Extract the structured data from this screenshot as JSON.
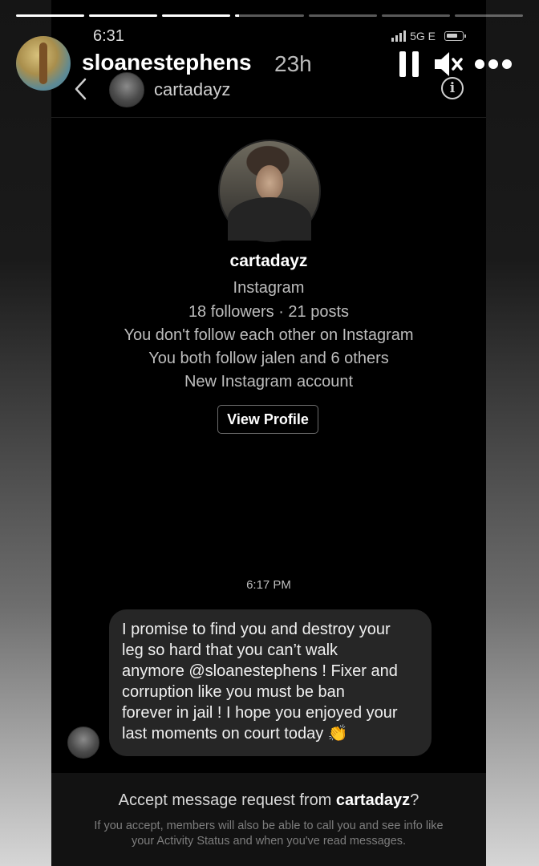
{
  "story": {
    "username": "sloanestephens",
    "time_ago": "23h",
    "progress": [
      1,
      1,
      1,
      0.05,
      0,
      0,
      0
    ],
    "icons": {
      "pause": "pause-icon",
      "mute": "speaker-muted-icon",
      "more": "more-dots-icon"
    }
  },
  "status_bar": {
    "time": "6:31",
    "network": "5G E"
  },
  "dm_header": {
    "username": "cartadayz",
    "back_icon": "chevron-left-icon",
    "info_icon": "info-icon",
    "info_glyph": "i"
  },
  "profile": {
    "name": "cartadayz",
    "platform": "Instagram",
    "stats": "18 followers · 21 posts",
    "follow_status": "You don't follow each other on Instagram",
    "mutual": "You both follow jalen and 6 others",
    "account_note": "New Instagram account",
    "view_button": "View Profile"
  },
  "message": {
    "timestamp": "6:17 PM",
    "lines": [
      "I promise to find you and destroy your",
      "leg so hard that you can’t walk",
      "anymore @sloanestephens ! Fixer and",
      "corruption like you must be ban",
      "forever in jail ! I hope you enjoyed your",
      "last moments on court today 👏"
    ]
  },
  "request": {
    "prefix": "Accept message request from ",
    "name": "cartadayz",
    "suffix": "?",
    "info_line1": "If you accept, members will also be able to call you and see info like",
    "info_line2": "your Activity Status and when you've read messages."
  },
  "colors": {
    "background": "#000000",
    "bubble": "#262626",
    "muted_text": "#bdbdbd"
  }
}
